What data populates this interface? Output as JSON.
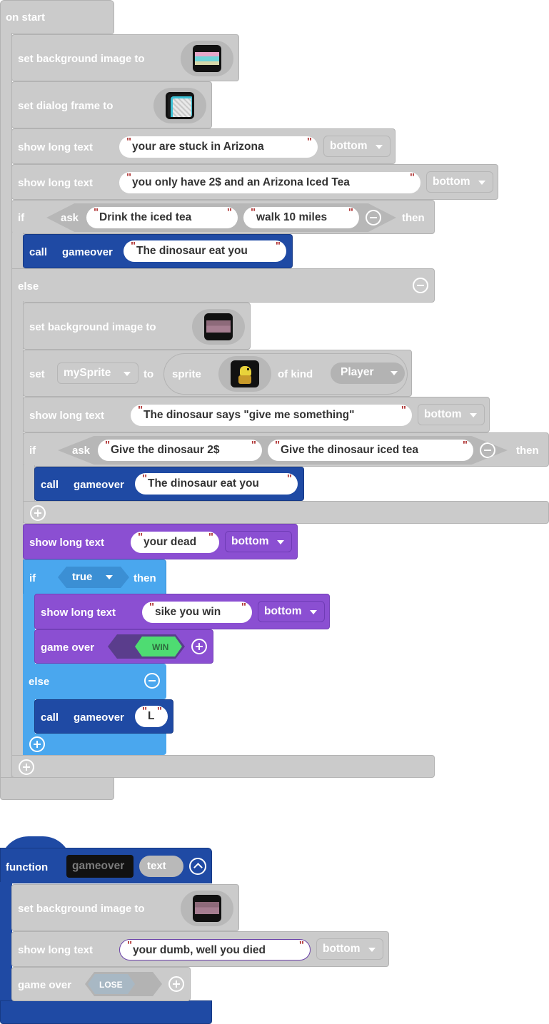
{
  "colors": {
    "events": "#cbcbcb",
    "functions": "#1f4aa4",
    "text": "#8b4fd2",
    "logic": "#4aa7ee",
    "win_hex": "#4edc72",
    "lose_hex": "#a8b8c4"
  },
  "on_start": {
    "hat_label": "on start",
    "set_bg_label": "set background image to",
    "set_dialog_label": "set dialog frame to",
    "show1": {
      "label": "show long text",
      "text": "your are stuck in Arizona",
      "pos": "bottom"
    },
    "show2": {
      "label": "show long text",
      "text": "you only have 2$ and an Arizona Iced Tea",
      "pos": "bottom"
    },
    "if1": {
      "if_label": "if",
      "ask_label": "ask",
      "option_a": "Drink the iced tea",
      "option_b": "walk 10 miles",
      "then_label": "then"
    },
    "call1": {
      "call_label": "call",
      "func_name": "gameover",
      "arg": "The dinosaur eat you"
    },
    "else_label": "else",
    "set_bg2_label": "set background image to",
    "set_sprite": {
      "set_label": "set",
      "var": "mySprite",
      "to_label": "to",
      "sprite_label": "sprite",
      "kind_label": "of kind",
      "kind": "Player"
    },
    "show3": {
      "label": "show long text",
      "text": "The dinosaur says \"give me something\"",
      "pos": "bottom"
    },
    "if2": {
      "if_label": "if",
      "ask_label": "ask",
      "option_a": "Give the dinosaur 2$",
      "option_b": "Give the dinosaur iced tea",
      "then_label": "then"
    },
    "call2": {
      "call_label": "call",
      "func_name": "gameover",
      "arg": "The dinosaur eat you"
    },
    "show4": {
      "label": "show long text",
      "text": "your dead",
      "pos": "bottom"
    },
    "if3": {
      "if_label": "if",
      "cond": "true",
      "then_label": "then"
    },
    "show5": {
      "label": "show long text",
      "text": "sike you win",
      "pos": "bottom"
    },
    "gameover_win": {
      "label": "game over",
      "value": "WIN"
    },
    "else2_label": "else",
    "call3": {
      "call_label": "call",
      "func_name": "gameover",
      "arg": "L"
    }
  },
  "function_block": {
    "label": "function",
    "name": "gameover",
    "param": "text",
    "set_bg_label": "set background image to",
    "show": {
      "label": "show long text",
      "text": "your dumb, well you died",
      "pos": "bottom"
    },
    "gameover_lose": {
      "label": "game over",
      "value": "LOSE"
    }
  }
}
